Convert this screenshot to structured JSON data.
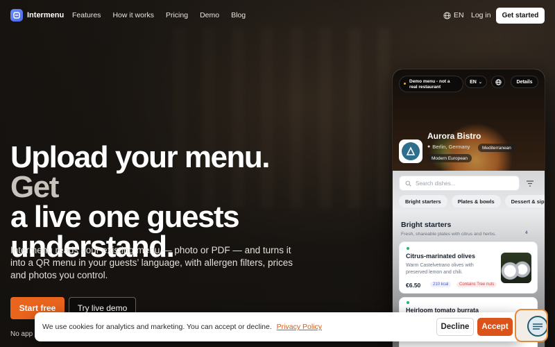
{
  "nav": {
    "brand": "Intermenu",
    "links": [
      "Features",
      "How it works",
      "Pricing",
      "Demo",
      "Blog"
    ],
    "language": "EN",
    "login": "Log in",
    "cta": "Get started"
  },
  "hero": {
    "headline_main": "Upload your menu.",
    "headline_muted_1": "Get",
    "headline_muted_2": "a live one guests",
    "headline_muted_3": "understand.",
    "subtext": "Intermenu reads your existing menu — photo or PDF — and turns it into a QR menu in your guests’ language, with allergen filters, prices and photos you control.",
    "primary_cta": "Start free",
    "secondary_cta": "Try live demo",
    "note": "No app t"
  },
  "phone": {
    "demo_notice": "Demo menu - not a real restaurant",
    "language": "EN",
    "details": "Details",
    "restaurant_name": "Aurora Bistro",
    "location": "Berlin, Germany",
    "tags": [
      "Mediterranean",
      "Modern European"
    ],
    "search_placeholder": "Search dishes...",
    "tabs": [
      "Bright starters",
      "Plates & bowls",
      "Dessert & sips"
    ],
    "section": {
      "title": "Bright starters",
      "subtitle": "Fresh, shareable plates with citrus and herbs.",
      "count": "4"
    },
    "dishes": [
      {
        "name": "Citrus-marinated olives",
        "description": "Warm Castelvetrano olives with preserved lemon and chili.",
        "price": "€6.50",
        "kcal": "210 kcal",
        "allergen": "Contains Tree nuts"
      },
      {
        "name": "Heirloom tomato burrata"
      }
    ]
  },
  "cookie": {
    "text": "We use cookies for analytics and marketing. You can accept or decline.",
    "link": "Privacy Policy",
    "decline": "Decline",
    "accept": "Accept"
  },
  "colors": {
    "accent": "#e9641c",
    "brand": "#4a6ae8"
  }
}
